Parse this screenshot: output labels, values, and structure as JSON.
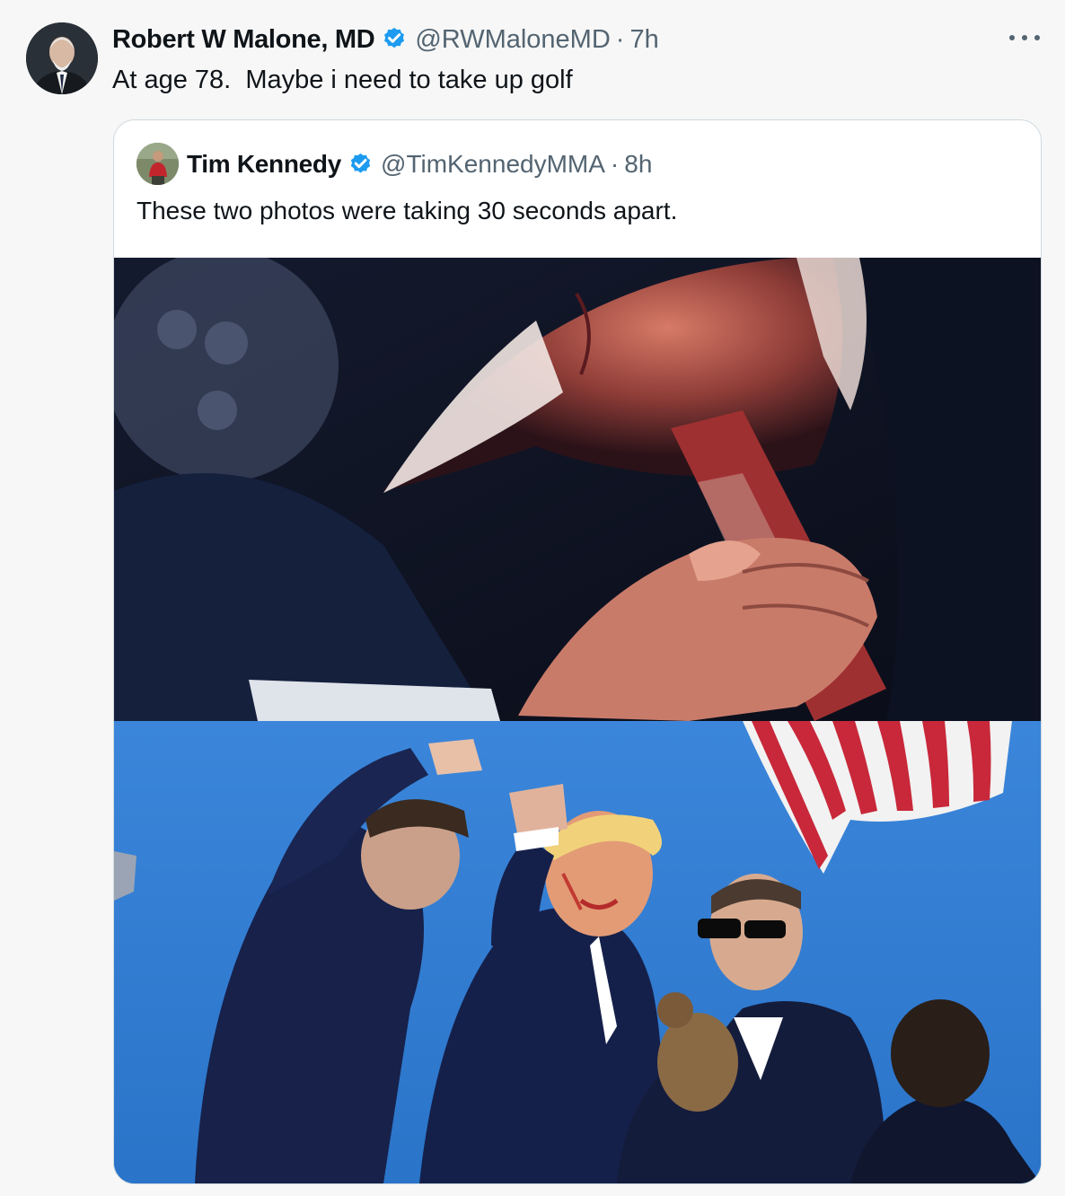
{
  "tweet": {
    "author_name": "Robert W Malone, MD",
    "author_handle": "@RWMaloneMD",
    "separator": "·",
    "time": "7h",
    "text": "At age 78.  Maybe i need to take up golf",
    "avatar_icon": "profile-photo",
    "verified_icon": "verified-badge-icon",
    "more_icon": "more-options-icon"
  },
  "quoted_tweet": {
    "author_name": "Tim Kennedy",
    "author_handle": "@TimKennedyMMA",
    "separator": "·",
    "time": "8h",
    "text": "These two photos were taking 30 seconds apart.",
    "avatar_icon": "profile-photo",
    "verified_icon": "verified-badge-icon",
    "images": [
      {
        "name": "photo-close-up"
      },
      {
        "name": "photo-rally-fist"
      }
    ]
  },
  "colors": {
    "background": "#f7f7f7",
    "verified_blue": "#1d9bf0",
    "secondary_text": "#536471",
    "border": "#cfd9de",
    "sky_blue": "#2f7fd4",
    "flag_red": "#c8283a"
  }
}
